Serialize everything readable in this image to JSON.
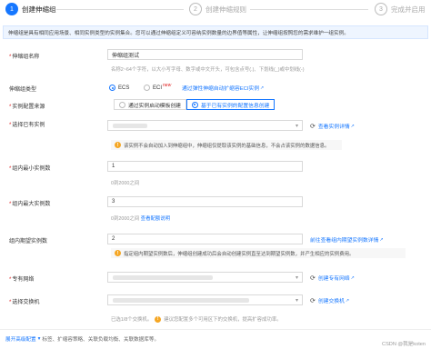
{
  "steps": [
    {
      "num": "1",
      "label": "创建伸缩组"
    },
    {
      "num": "2",
      "label": "创建伸缩规则"
    },
    {
      "num": "3",
      "label": "完成并启用"
    }
  ],
  "banner": "伸缩组是具有相同应用场景、相同实例类型的实例集合。您可以通过伸缩组定义可容纳实例数量的边界值等属性，让伸缩组按照您的需求维护一组实例。",
  "form": {
    "group_name": {
      "label": "伸缩组名称",
      "value": "伸缩组测试",
      "help": "名称2~64个字符，以大小写字母、数字或中文开头，可包含点号(.)、下划线(_)或中划线(-)"
    },
    "group_type": {
      "label": "伸缩组类型",
      "options": [
        "ECS",
        "ECI"
      ],
      "new_badge": "new",
      "link": "通过弹性伸缩自动扩缩容ECI实例"
    },
    "instance_source": {
      "label": "实例配置来源",
      "options": [
        "通过实例启动模板创建",
        "基于已有实例的配置信息创建"
      ]
    },
    "existing_instance": {
      "label": "选择已有实例",
      "link": "查看实例详情",
      "warning": "该实例不会自动加入到伸缩组中，伸缩组仅提取该实例的基础信息，不会占该实例的数据信息。"
    },
    "min_instances": {
      "label": "组内最小实例数",
      "value": "1",
      "help": "0到2000之间"
    },
    "max_instances": {
      "label": "组内最大实例数",
      "value": "3",
      "help": "0到2000之间",
      "help_link": "查看配额说明"
    },
    "desired_instances": {
      "label": "组内期望实例数",
      "value": "2",
      "link": "前往查看组内期望实例数详情",
      "warning": "指定组内期望实例数后，伸缩组创建成功后会自动创建实例直至达到期望实例数，并产生相应的实例费用。"
    },
    "vpc": {
      "label": "专有网络",
      "link": "创建专有网络"
    },
    "vswitch": {
      "label": "选择交换机",
      "link": "创建交换机",
      "help": "已选1/8个交换机。",
      "help_tip": "建议您配置多个可用区下的交换机，提高扩容成功率。"
    }
  },
  "footer": {
    "advanced": "展开高级配置",
    "chevron": "▾",
    "desc": "标签、扩缩容策略、关联负载均衡、关联数据库等。"
  },
  "watermark": "CSDN @我是koten",
  "colors": {
    "accent": "#1677ff",
    "warning": "#f5a623",
    "required": "#e02020"
  }
}
